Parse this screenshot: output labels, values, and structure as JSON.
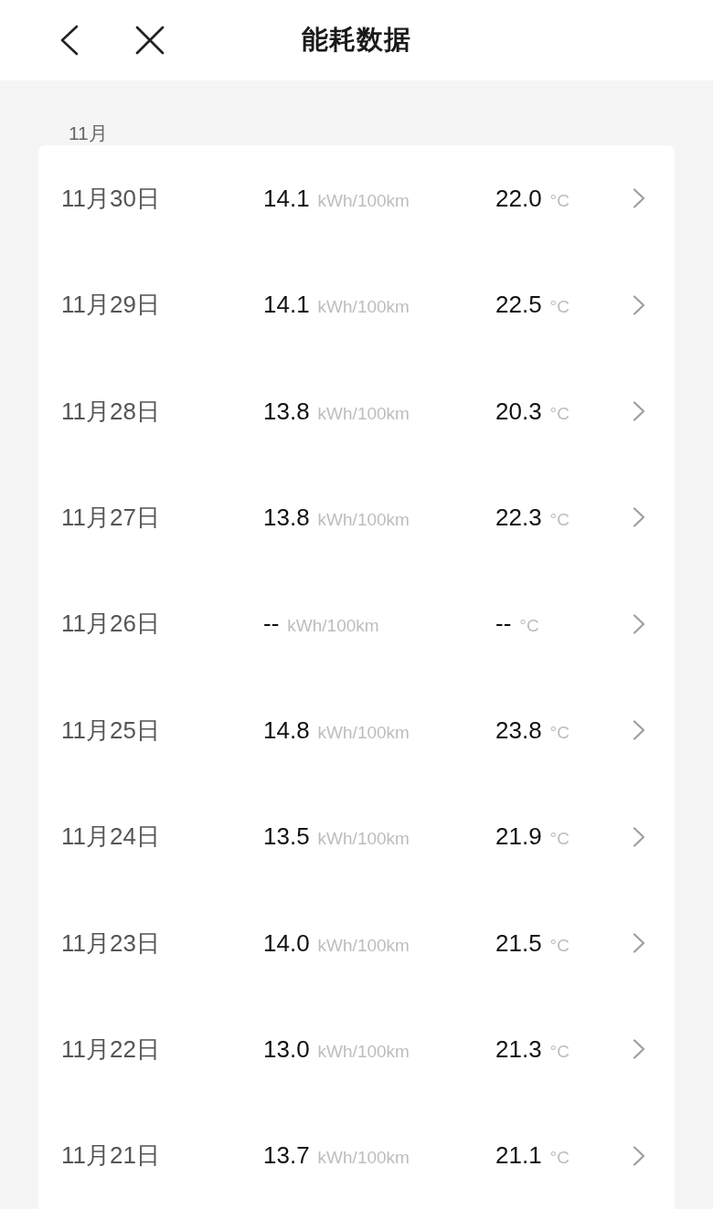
{
  "header": {
    "title": "能耗数据"
  },
  "section": {
    "month": "11月"
  },
  "rows": [
    {
      "date": "11月30日",
      "consumption": "14.1",
      "consumption_unit": "kWh/100km",
      "temperature": "22.0",
      "temperature_unit": "°C"
    },
    {
      "date": "11月29日",
      "consumption": "14.1",
      "consumption_unit": "kWh/100km",
      "temperature": "22.5",
      "temperature_unit": "°C"
    },
    {
      "date": "11月28日",
      "consumption": "13.8",
      "consumption_unit": "kWh/100km",
      "temperature": "20.3",
      "temperature_unit": "°C"
    },
    {
      "date": "11月27日",
      "consumption": "13.8",
      "consumption_unit": "kWh/100km",
      "temperature": "22.3",
      "temperature_unit": "°C"
    },
    {
      "date": "11月26日",
      "consumption": "--",
      "consumption_unit": "kWh/100km",
      "temperature": "--",
      "temperature_unit": "°C"
    },
    {
      "date": "11月25日",
      "consumption": "14.8",
      "consumption_unit": "kWh/100km",
      "temperature": "23.8",
      "temperature_unit": "°C"
    },
    {
      "date": "11月24日",
      "consumption": "13.5",
      "consumption_unit": "kWh/100km",
      "temperature": "21.9",
      "temperature_unit": "°C"
    },
    {
      "date": "11月23日",
      "consumption": "14.0",
      "consumption_unit": "kWh/100km",
      "temperature": "21.5",
      "temperature_unit": "°C"
    },
    {
      "date": "11月22日",
      "consumption": "13.0",
      "consumption_unit": "kWh/100km",
      "temperature": "21.3",
      "temperature_unit": "°C"
    },
    {
      "date": "11月21日",
      "consumption": "13.7",
      "consumption_unit": "kWh/100km",
      "temperature": "21.1",
      "temperature_unit": "°C"
    }
  ]
}
